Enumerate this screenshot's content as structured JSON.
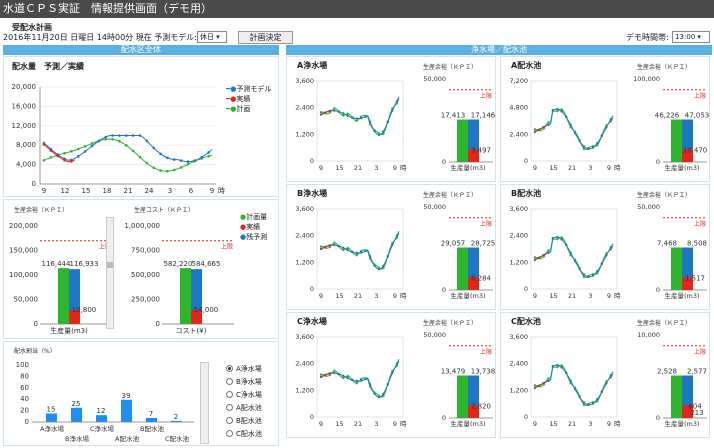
{
  "app": {
    "title": "水道ＣＰＳ実証　情報提供画面（デモ用）"
  },
  "header": {
    "section": "受配水計画",
    "date_line": "2016年11月20日 日曜日 14時00分 現在 予測モデル:",
    "model_value": "休日 ▾",
    "decide_label": "計画決定",
    "demo_time_label": "デモ時間帯:",
    "demo_time_value": "13:00 ▾"
  },
  "bands": {
    "left": "配水区全体",
    "right": "浄水場／配水池"
  },
  "left": {
    "main_title": "配水量　予測／実績",
    "legend": [
      "予測モデル",
      "実績",
      "計画"
    ],
    "yticks": [
      "20,000",
      "16,000",
      "12,000",
      "8,000",
      "4,000",
      "0"
    ],
    "xticks": [
      "9",
      "12",
      "15",
      "18",
      "21",
      "24",
      "3",
      "6",
      "9"
    ],
    "xunit": "時",
    "kpi_title1": "生産余裕（ＫＰＩ）",
    "kpi_title2": "生産コスト（ＫＰＩ）",
    "kpi1_ticks": [
      "200,000",
      "150,000",
      "100,000",
      "50,000",
      "0"
    ],
    "kpi2_ticks": [
      "1,000,000",
      "750,000",
      "500,000",
      "250,000",
      "0"
    ],
    "kpi1_vals": [
      "116,444",
      "116,933",
      "10,800"
    ],
    "kpi2_vals": [
      "582,220",
      "584,665",
      "54,000"
    ],
    "kpi1_axis": "生産量(m3)",
    "kpi2_axis": "コスト(¥)",
    "upper": "上限",
    "kpi_legend": [
      "計画量",
      "実績",
      "残予測"
    ],
    "ratio_title": "配水割当（%）",
    "ratio_ticks": [
      "100",
      "80",
      "60",
      "40",
      "20",
      "0"
    ],
    "ratio_vals": [
      "15",
      "25",
      "12",
      "39",
      "7",
      "2"
    ],
    "ratio_labels_top": [
      "A浄水場",
      "C浄水場",
      "B配水池"
    ],
    "ratio_labels_bot": [
      "B浄水場",
      "A配水池",
      "C配水池"
    ],
    "radio": [
      "A浄水場",
      "B浄水場",
      "C浄水場",
      "A配水池",
      "B配水池",
      "C配水池"
    ]
  },
  "facilities": [
    {
      "name": "A浄水場",
      "yticks": [
        "3,600",
        "2,400",
        "1,200",
        "0"
      ],
      "kticks": [
        "50,000",
        "0"
      ],
      "vals": [
        "17,413",
        "17,146",
        "3,497"
      ]
    },
    {
      "name": "A配水池",
      "yticks": [
        "7,200",
        "4,800",
        "2,400",
        "0"
      ],
      "kticks": [
        "100,000",
        "0"
      ],
      "vals": [
        "46,226",
        "47,053",
        "10,470"
      ]
    },
    {
      "name": "B浄水場",
      "yticks": [
        "3,600",
        "2,400",
        "1,200",
        "0"
      ],
      "kticks": [
        "50,000",
        "0"
      ],
      "vals": [
        "29,057",
        "28,725",
        "6,284"
      ]
    },
    {
      "name": "B配水池",
      "yticks": [
        "3,600",
        "2,400",
        "1,200",
        "0"
      ],
      "kticks": [
        "50,000",
        "0"
      ],
      "vals": [
        "7,468",
        "8,508",
        "1,517"
      ]
    },
    {
      "name": "C浄水場",
      "yticks": [
        "3,600",
        "2,400",
        "1,200",
        "0"
      ],
      "kticks": [
        "50,000",
        "0"
      ],
      "vals": [
        "13,479",
        "13,738",
        "2,820"
      ]
    },
    {
      "name": "C配水池",
      "yticks": [
        "3,600",
        "2,400",
        "1,200",
        "0"
      ],
      "kticks": [
        "10,000",
        "0"
      ],
      "vals": [
        "2,528",
        "2,577",
        "604",
        "213"
      ]
    }
  ],
  "fac_xticks": [
    "9",
    "15",
    "21",
    "3",
    "9"
  ],
  "fac_xunit": "時",
  "kpi_small_title": "生産余裕（ＫＰＩ）",
  "kpi_axis": "生産量(m3)"
}
